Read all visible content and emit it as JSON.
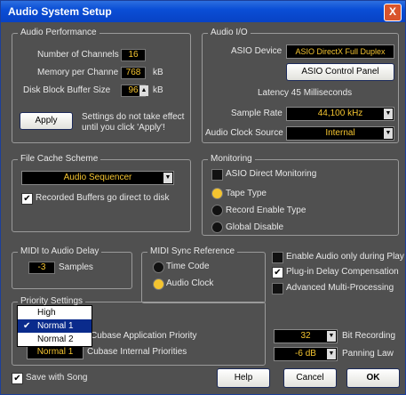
{
  "window": {
    "title": "Audio System Setup",
    "close_glyph": "X"
  },
  "audio_performance": {
    "title": "Audio Performance",
    "channels_label": "Number of Channels",
    "channels_value": "16",
    "memory_label": "Memory per Channe",
    "memory_value": "768",
    "memory_unit": "kB",
    "block_label": "Disk Block Buffer Size",
    "block_value": "96",
    "block_unit": "kB",
    "apply_label": "Apply",
    "apply_note_1": "Settings do not take effect",
    "apply_note_2": "until you click 'Apply'!"
  },
  "audio_io": {
    "title": "Audio I/O",
    "device_label": "ASIO Device",
    "device_value": "ASIO DirectX Full Duplex",
    "control_panel_label": "ASIO Control Panel",
    "latency_text": "Latency 45 Milliseconds",
    "sample_rate_label": "Sample Rate",
    "sample_rate_value": "44,100 kHz",
    "clock_label": "Audio Clock Source",
    "clock_value": "Internal"
  },
  "file_cache": {
    "title": "File Cache Scheme",
    "scheme_value": "Audio Sequencer",
    "recorded_label": "Recorded Buffers go direct to disk",
    "recorded_checked": true
  },
  "monitoring": {
    "title": "Monitoring",
    "asio_direct_label": "ASIO Direct Monitoring",
    "options": [
      "Tape Type",
      "Record Enable Type",
      "Global Disable"
    ],
    "selected": "Tape Type"
  },
  "midi_delay": {
    "title": "MIDI to Audio Delay",
    "value": "-3",
    "unit": "Samples"
  },
  "midi_sync": {
    "title": "MIDI Sync Reference",
    "options": [
      "Time Code",
      "Audio Clock"
    ],
    "selected": "Audio Clock"
  },
  "options": [
    {
      "label": "Enable Audio only during Play",
      "checked": false
    },
    {
      "label": "Plug-in Delay Compensation",
      "checked": true
    },
    {
      "label": "Advanced Multi-Processing",
      "checked": false
    }
  ],
  "priority": {
    "title": "Priority Settings",
    "app_label": "Cubase Application Priority",
    "internal_label": "Cubase Internal Priorities",
    "internal_value": "Normal 1",
    "menu_items": [
      "High",
      "Normal 1",
      "Normal 2"
    ],
    "menu_selected": "Normal 1"
  },
  "bit_recording": {
    "value": "32",
    "label": "Bit Recording"
  },
  "panning": {
    "value": "-6 dB",
    "label": "Panning Law"
  },
  "save_with_song": {
    "label": "Save with Song",
    "checked": true
  },
  "buttons": {
    "help": "Help",
    "cancel": "Cancel",
    "ok": "OK"
  },
  "colors": {
    "titlebar": "#0a4ed6",
    "panel": "#505050",
    "value_text": "#f4c430"
  }
}
